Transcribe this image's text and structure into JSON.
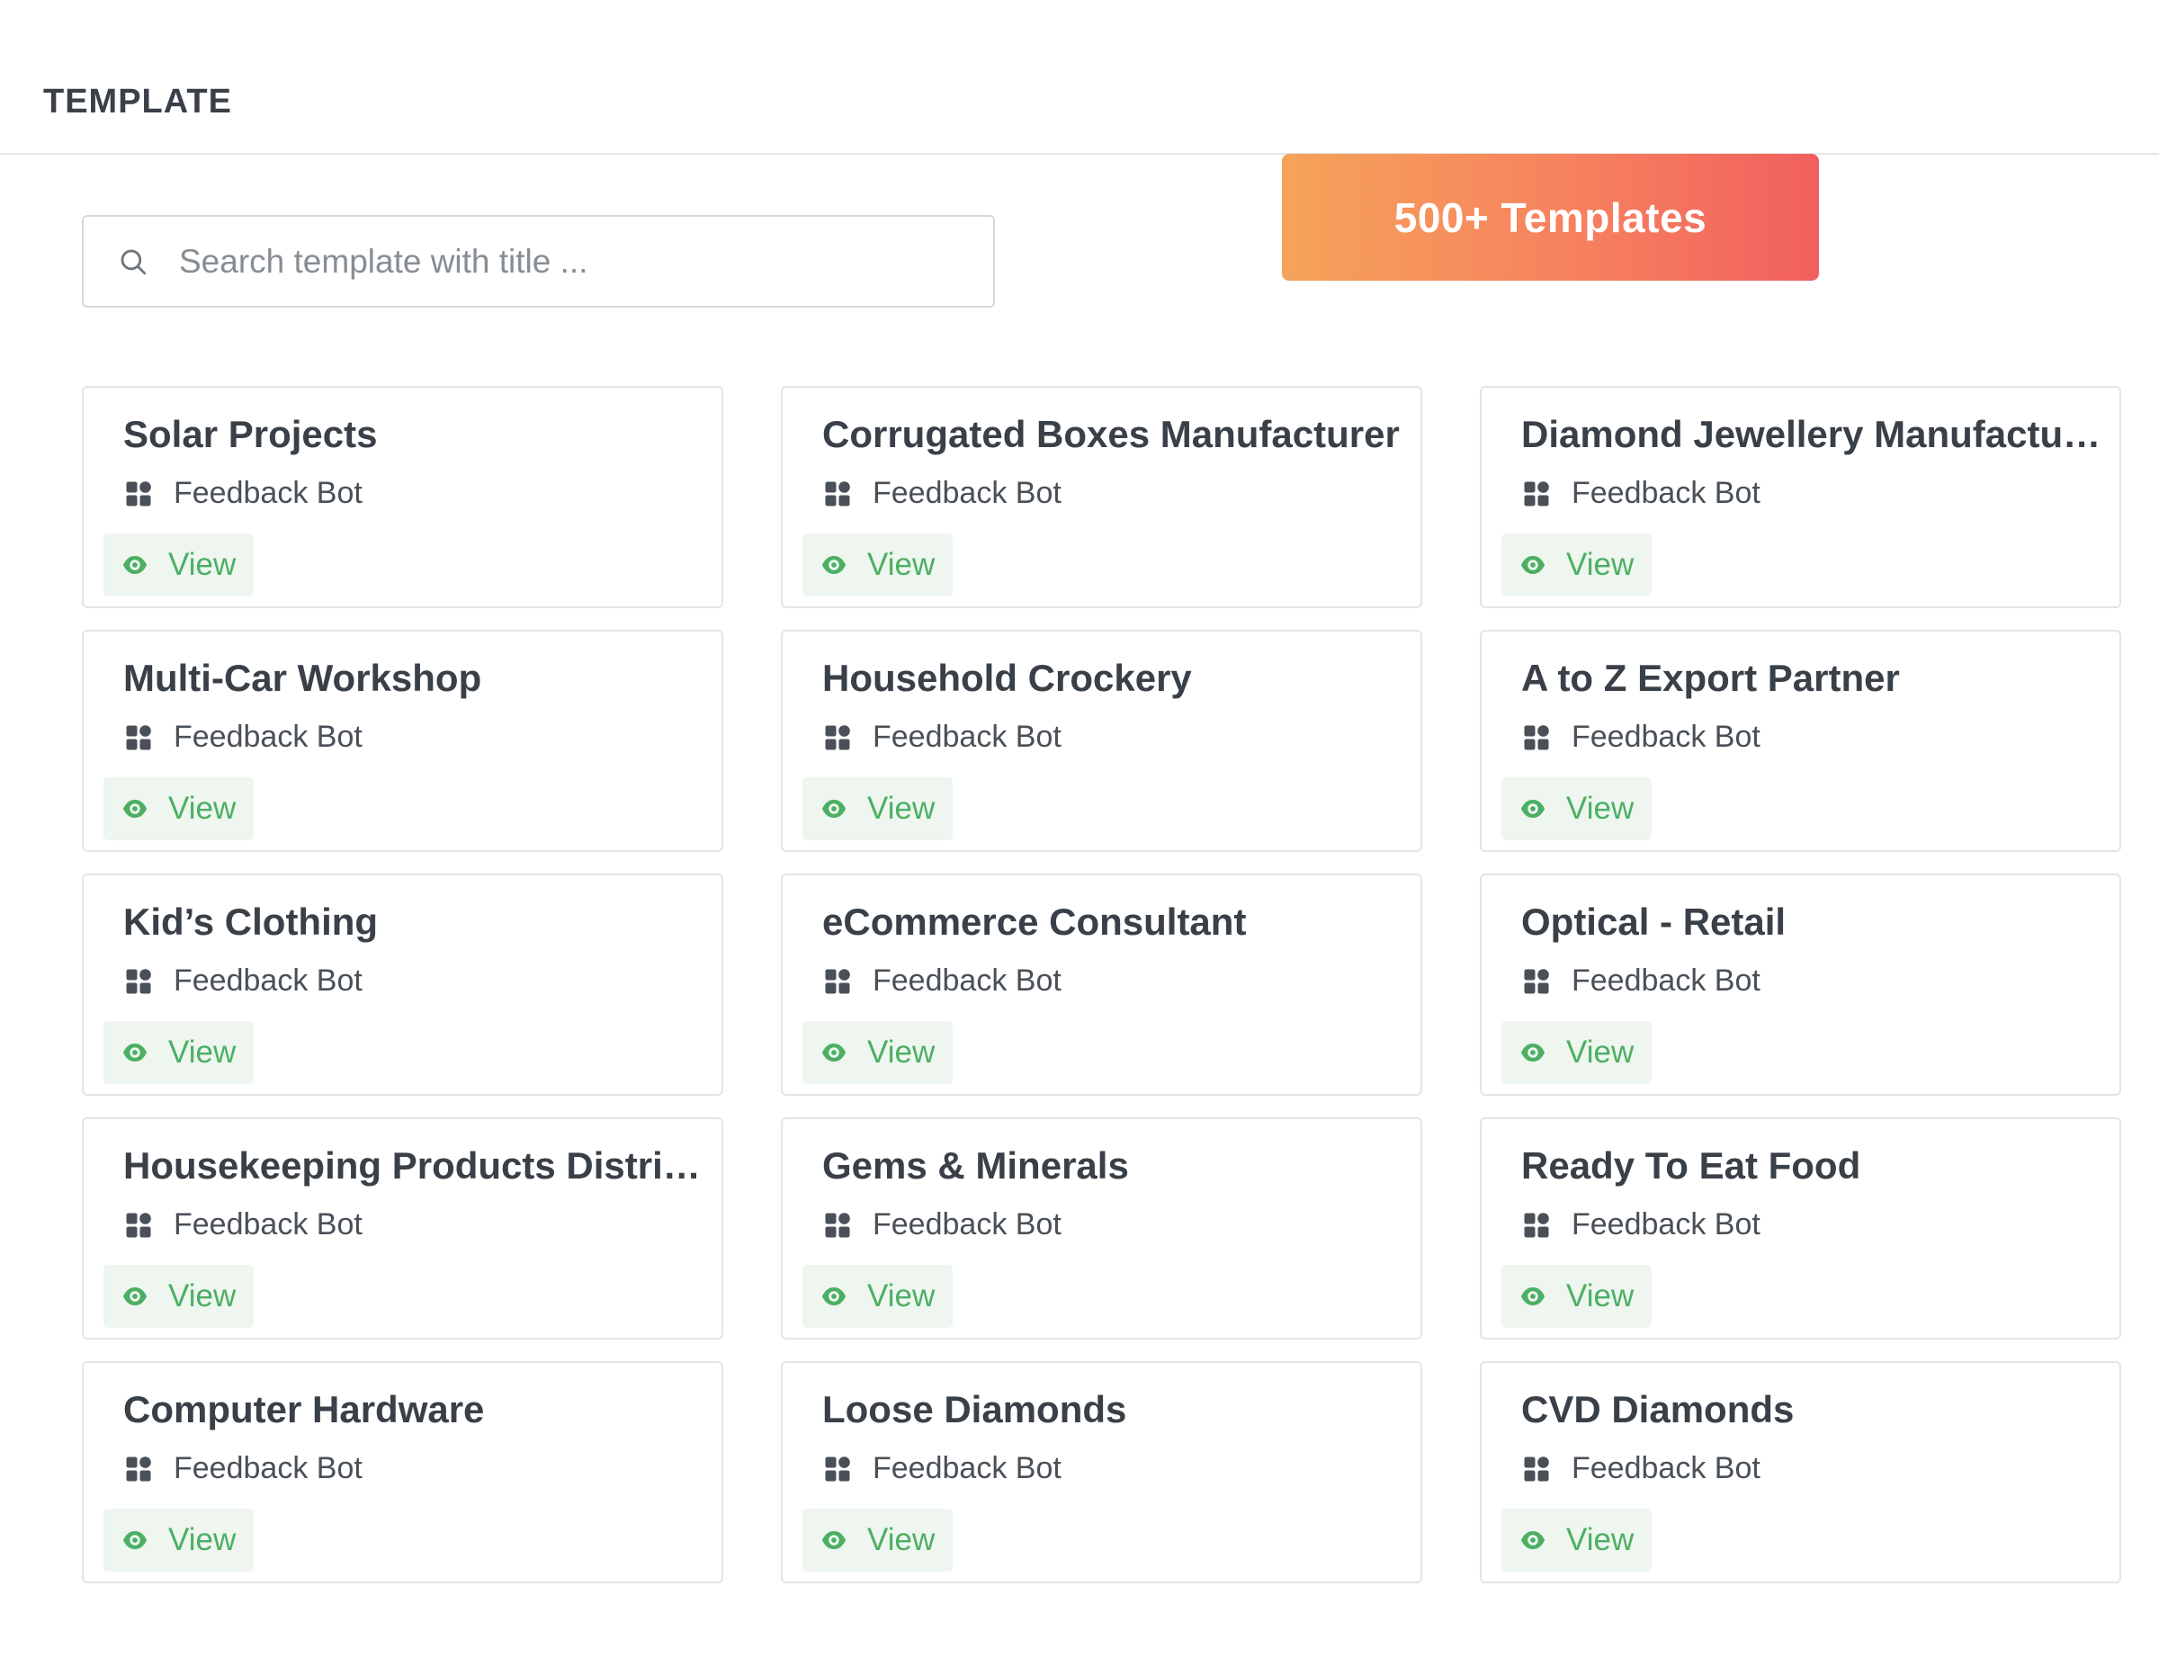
{
  "header": {
    "title": "TEMPLATE"
  },
  "promo": {
    "label": "500+ Templates"
  },
  "search": {
    "placeholder": "Search template with title ...",
    "value": ""
  },
  "icons": {
    "search": "search-icon",
    "category": "grid-icon",
    "view": "eye-icon"
  },
  "colors": {
    "accent_green": "#4caf63",
    "banner_gradient_start": "#f5a35a",
    "banner_gradient_end": "#f2605e"
  },
  "templates": [
    {
      "title": "Solar Projects",
      "category": "Feedback Bot",
      "action": "View"
    },
    {
      "title": "Corrugated Boxes Manufacturer",
      "category": "Feedback Bot",
      "action": "View"
    },
    {
      "title": "Diamond Jewellery Manufacturer",
      "category": "Feedback Bot",
      "action": "View"
    },
    {
      "title": "Multi-Car Workshop",
      "category": "Feedback Bot",
      "action": "View"
    },
    {
      "title": "Household Crockery",
      "category": "Feedback Bot",
      "action": "View"
    },
    {
      "title": "A to Z Export Partner",
      "category": "Feedback Bot",
      "action": "View"
    },
    {
      "title": "Kid’s Clothing",
      "category": "Feedback Bot",
      "action": "View"
    },
    {
      "title": "eCommerce Consultant",
      "category": "Feedback Bot",
      "action": "View"
    },
    {
      "title": "Optical - Retail",
      "category": "Feedback Bot",
      "action": "View"
    },
    {
      "title": "Housekeeping Products Distribu...",
      "category": "Feedback Bot",
      "action": "View"
    },
    {
      "title": "Gems & Minerals",
      "category": "Feedback Bot",
      "action": "View"
    },
    {
      "title": "Ready To Eat Food",
      "category": "Feedback Bot",
      "action": "View"
    },
    {
      "title": "Computer Hardware",
      "category": "Feedback Bot",
      "action": "View"
    },
    {
      "title": "Loose Diamonds",
      "category": "Feedback Bot",
      "action": "View"
    },
    {
      "title": "CVD Diamonds",
      "category": "Feedback Bot",
      "action": "View"
    }
  ]
}
